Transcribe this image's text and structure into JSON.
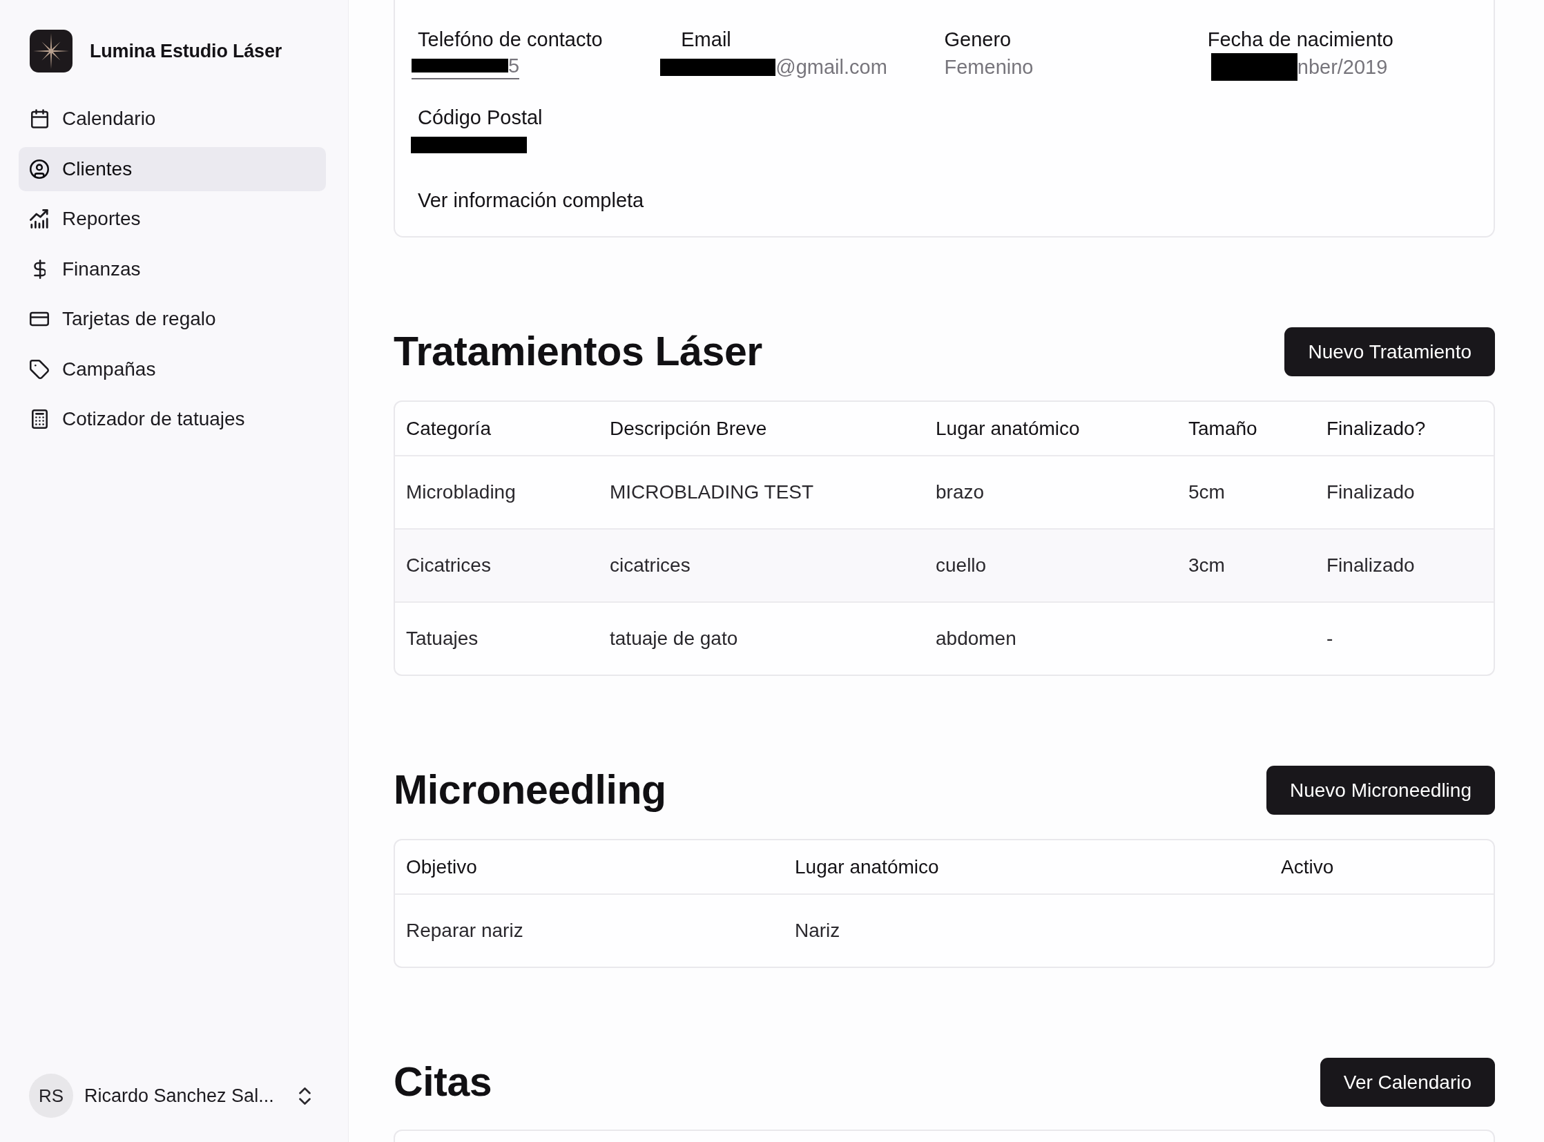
{
  "sidebar": {
    "brand": {
      "name": "Lumina Estudio Láser"
    },
    "nav_items": [
      {
        "label": "Calendario",
        "selected": false
      },
      {
        "label": "Clientes",
        "selected": true
      },
      {
        "label": "Reportes",
        "selected": false
      },
      {
        "label": "Finanzas",
        "selected": false
      },
      {
        "label": "Tarjetas de regalo",
        "selected": false
      },
      {
        "label": "Campañas",
        "selected": false
      },
      {
        "label": "Cotizador de tatuajes",
        "selected": false
      }
    ],
    "user": {
      "initials": "RS",
      "name": "Ricardo Sanchez Sal..."
    }
  },
  "client_info": {
    "fields": [
      {
        "label": "Telefóno de contacto",
        "value": "5",
        "redacted": true,
        "kind": "link"
      },
      {
        "label": "Email",
        "value": "@gmail.com",
        "redacted": true,
        "kind": "text"
      },
      {
        "label": "Genero",
        "value": "Femenino",
        "redacted": false,
        "kind": "text"
      },
      {
        "label": "Fecha de nacimiento",
        "value": "nber/2019",
        "redacted": true,
        "kind": "text"
      },
      {
        "label": "Código Postal",
        "redacted": true,
        "kind": "text"
      }
    ],
    "full_info_link": "Ver información completa"
  },
  "sections": [
    {
      "title": "Tratamientos Láser",
      "button": "Nuevo Tratamiento",
      "table": {
        "columns": [
          "Categoría",
          "Descripción Breve",
          "Lugar anatómico",
          "Tamaño",
          "Finalizado?"
        ],
        "rows": [
          [
            "Microblading",
            "MICROBLADING TEST",
            "brazo",
            "5cm",
            "Finalizado"
          ],
          [
            "Cicatrices",
            "cicatrices",
            "cuello",
            "3cm",
            "Finalizado"
          ],
          [
            "Tatuajes",
            "tatuaje de gato",
            "abdomen",
            null,
            "-"
          ]
        ]
      }
    },
    {
      "title": "Microneedling",
      "button": "Nuevo Microneedling",
      "table": {
        "columns": [
          "Objetivo",
          "Lugar anatómico",
          "Activo"
        ],
        "rows": [
          [
            "Reparar nariz",
            "Nariz",
            null
          ]
        ]
      }
    },
    {
      "title": "Citas",
      "button": "Ver Calendario"
    }
  ]
}
